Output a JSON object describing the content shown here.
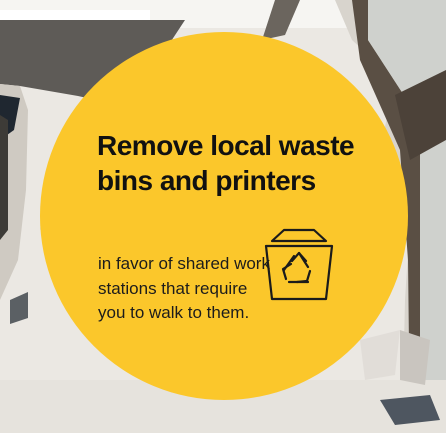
{
  "card": {
    "title": "Remove local waste bins and printers",
    "body": "in favor of shared work stations that require you to walk to them.",
    "accent_color": "#fbc72b",
    "text_color": "#111111"
  },
  "icons": {
    "bin": "recycling-bin-icon"
  }
}
